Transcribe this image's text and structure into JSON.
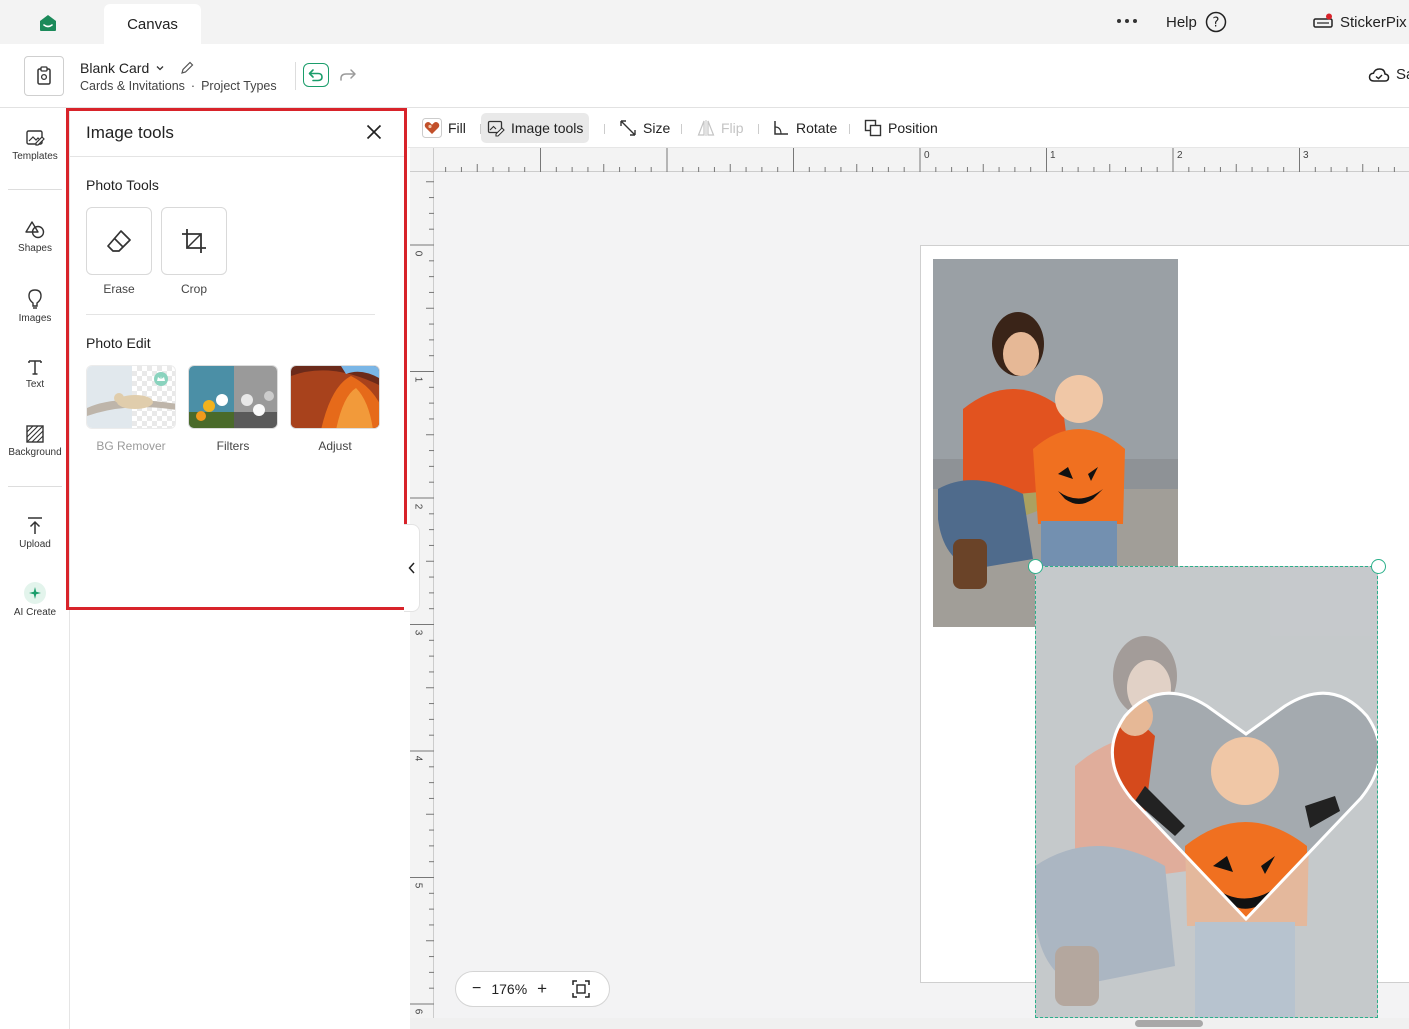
{
  "topbar": {
    "tab_label": "Canvas",
    "help_label": "Help",
    "profile_label": "StickerPix I"
  },
  "project": {
    "title": "Blank Card",
    "breadcrumb_1": "Cards & Invitations",
    "breadcrumb_sep": "·",
    "breadcrumb_2": "Project Types",
    "save_label": "Sa"
  },
  "rail": {
    "items": [
      {
        "label": "Templates",
        "icon": "templates-icon"
      },
      {
        "label": "Shapes",
        "icon": "shapes-icon"
      },
      {
        "label": "Images",
        "icon": "images-icon"
      },
      {
        "label": "Text",
        "icon": "text-icon"
      },
      {
        "label": "Background",
        "icon": "background-icon"
      },
      {
        "label": "Upload",
        "icon": "upload-icon"
      },
      {
        "label": "AI Create",
        "icon": "ai-sparkle-icon"
      }
    ]
  },
  "panel": {
    "title": "Image tools",
    "photo_tools_heading": "Photo Tools",
    "photo_tools": [
      {
        "label": "Erase",
        "icon": "eraser-icon"
      },
      {
        "label": "Crop",
        "icon": "crop-icon"
      }
    ],
    "photo_edit_heading": "Photo Edit",
    "photo_edit": [
      {
        "label": "BG Remover",
        "disabled": true,
        "premium": true
      },
      {
        "label": "Filters"
      },
      {
        "label": "Adjust"
      }
    ]
  },
  "toolbar": {
    "fill_label": "Fill",
    "image_tools_label": "Image tools",
    "size_label": "Size",
    "flip_label": "Flip",
    "rotate_label": "Rotate",
    "position_label": "Position"
  },
  "rulers": {
    "top": [
      "0",
      "1",
      "2",
      "3"
    ],
    "left": [
      "0",
      "1",
      "2",
      "3",
      "4",
      "5",
      "6"
    ]
  },
  "zoom": {
    "minus": "−",
    "value": "176%",
    "plus": "+"
  },
  "colors": {
    "accent": "#1b9d6b",
    "highlight_box": "#d8232a",
    "selection": "#2bb08a"
  }
}
